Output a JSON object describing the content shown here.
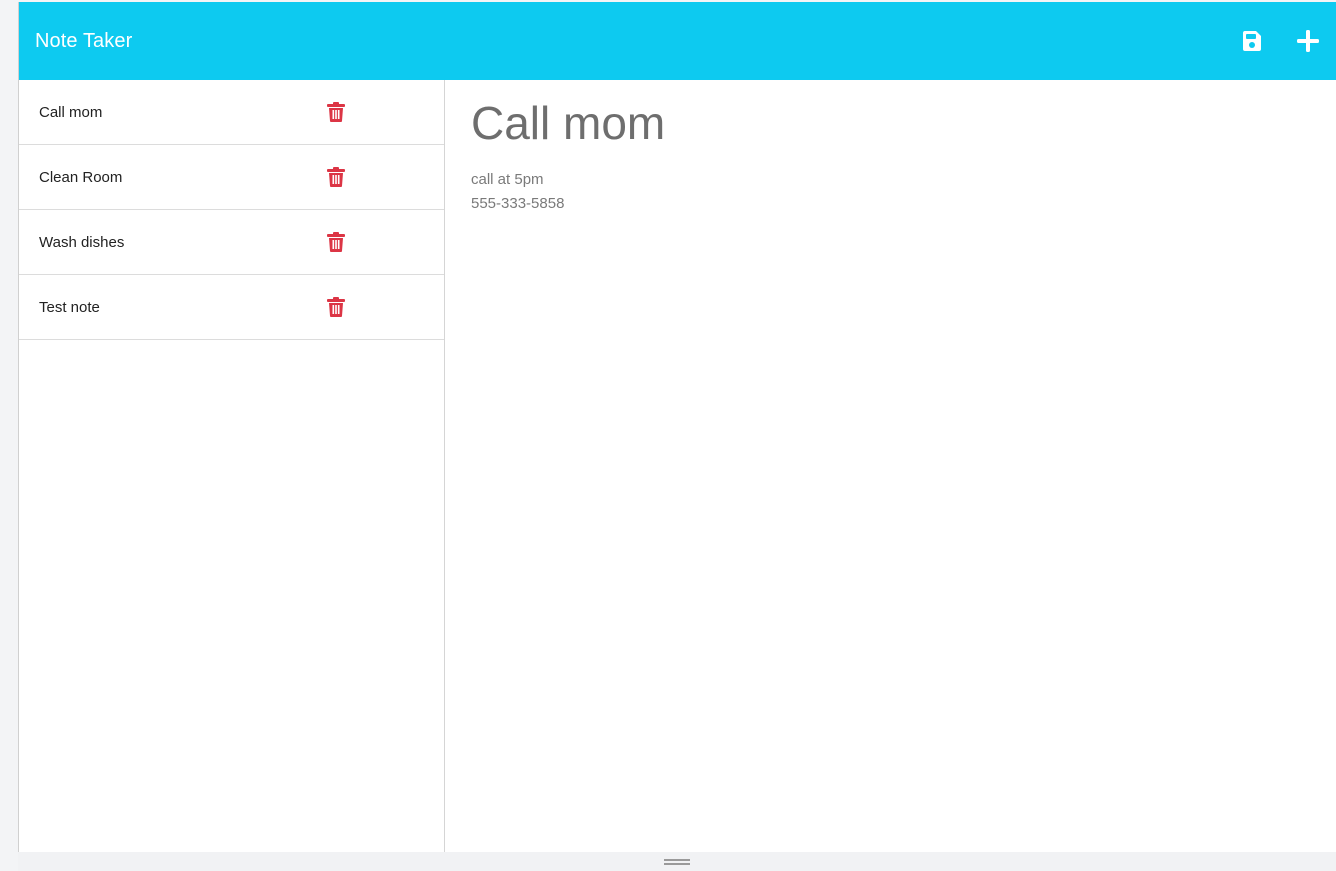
{
  "navbar": {
    "brand": "Note Taker",
    "background_color": "#0dcaf0",
    "icons": [
      "save-icon",
      "plus-icon"
    ]
  },
  "sidebar": {
    "notes": [
      {
        "title": "Call mom",
        "delete_icon": "trash-icon"
      },
      {
        "title": "Clean Room",
        "delete_icon": "trash-icon"
      },
      {
        "title": "Wash dishes",
        "delete_icon": "trash-icon"
      },
      {
        "title": "Test note",
        "delete_icon": "trash-icon"
      }
    ],
    "delete_color": "#dc3545"
  },
  "editor": {
    "title": "Call mom",
    "body_lines": [
      "call at 5pm",
      "555-333-5858"
    ]
  }
}
